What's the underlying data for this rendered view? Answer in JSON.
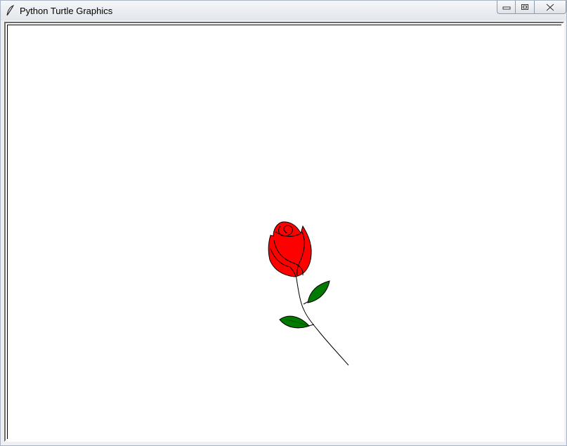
{
  "window": {
    "title": "Python Turtle Graphics",
    "app_icon": "feather-icon",
    "controls": [
      "minimize-icon",
      "maximize-icon",
      "close-icon"
    ]
  },
  "drawing": {
    "subject": "rose",
    "colors": {
      "petal": "#ff0000",
      "leaf": "#007a00",
      "outline": "#000000",
      "canvas": "#ffffff"
    }
  }
}
